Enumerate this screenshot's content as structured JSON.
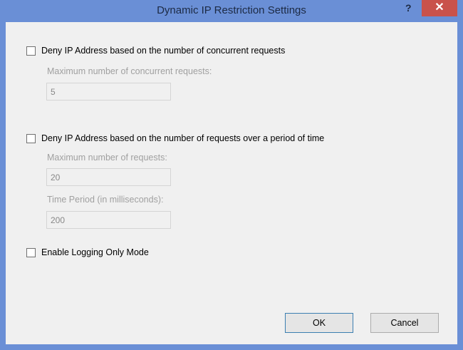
{
  "window": {
    "title": "Dynamic IP Restriction Settings",
    "help": "?",
    "close": "✕"
  },
  "concurrent": {
    "checkbox_label": "Deny IP Address based on the number of concurrent requests",
    "checked": false,
    "max_label": "Maximum number of concurrent requests:",
    "max_value": "5"
  },
  "rate": {
    "checkbox_label": "Deny IP Address based on the number of requests over a period of time",
    "checked": false,
    "max_label": "Maximum number of requests:",
    "max_value": "20",
    "period_label": "Time Period (in milliseconds):",
    "period_value": "200"
  },
  "logging": {
    "checkbox_label": "Enable Logging Only Mode",
    "checked": false
  },
  "buttons": {
    "ok": "OK",
    "cancel": "Cancel"
  }
}
